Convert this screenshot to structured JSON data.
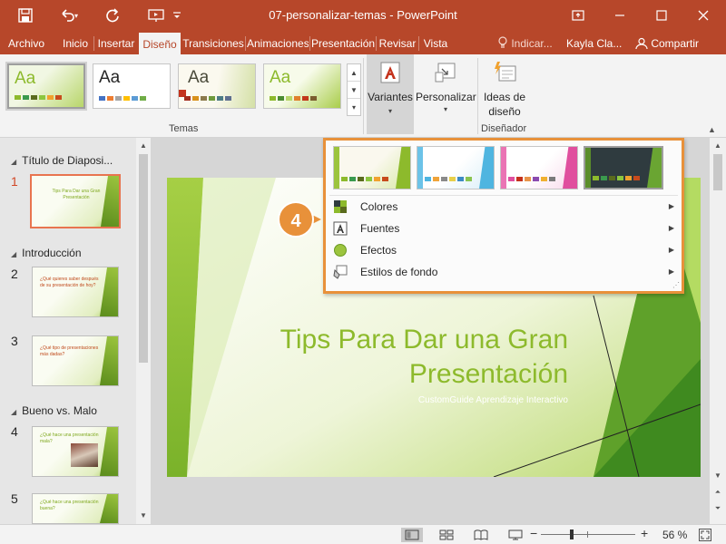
{
  "window": {
    "document_title": "07-personalizar-temas",
    "separator": "-",
    "app_name": "PowerPoint"
  },
  "colors": {
    "accent": "#b7472a",
    "highlight": "#e8913a",
    "theme_green": "#8dba2c",
    "selected_slide": "#e8744f"
  },
  "tabs": [
    {
      "label": "Archivo"
    },
    {
      "label": "Inicio"
    },
    {
      "label": "Insertar"
    },
    {
      "label": "Diseño",
      "active": true
    },
    {
      "label": "Transiciones"
    },
    {
      "label": "Animaciones"
    },
    {
      "label": "Presentación"
    },
    {
      "label": "Revisar"
    },
    {
      "label": "Vista"
    }
  ],
  "tell_me": {
    "label": "Indicar..."
  },
  "user": {
    "name": "Kayla Cla..."
  },
  "share": {
    "label": "Compartir"
  },
  "ribbon": {
    "themes_group_label": "Temas",
    "theme_sample": "Aa",
    "variants_label": "Variantes",
    "customize_label": "Personalizar",
    "design_ideas_label_1": "Ideas de",
    "design_ideas_label_2": "diseño",
    "designer_group_label": "Diseñador"
  },
  "variants_menu": {
    "items": [
      {
        "label": "Colores",
        "icon": "colors-icon"
      },
      {
        "label": "Fuentes",
        "icon": "fonts-icon"
      },
      {
        "label": "Efectos",
        "icon": "effects-icon"
      },
      {
        "label": "Estilos de fondo",
        "icon": "background-styles-icon"
      }
    ]
  },
  "callout": {
    "number": "4"
  },
  "slide_panel": {
    "sections": [
      {
        "title": "Título de Diaposi..."
      },
      {
        "title": "Introducción"
      },
      {
        "title": "Bueno vs. Malo"
      }
    ],
    "slides": [
      {
        "number": "1",
        "text": "Tips Para Dar una Gran Presentación"
      },
      {
        "number": "2",
        "text": "¿Qué quieres saber después de su presentación de hoy?"
      },
      {
        "number": "3",
        "text": "¿Qué tipo de presentaciones más dadas?"
      },
      {
        "number": "4",
        "text": "¿Qué hace una presentación mala?"
      },
      {
        "number": "5",
        "text": "¿Qué hace una presentación buena?"
      }
    ]
  },
  "slide": {
    "title_line1": "Tips Para Dar una Gran",
    "title_line2": "Presentación",
    "subtitle": "CustomGuide Aprendizaje Interactivo"
  },
  "status": {
    "zoom_minus": "−",
    "zoom_plus": "+",
    "zoom_percent": "56 %"
  }
}
